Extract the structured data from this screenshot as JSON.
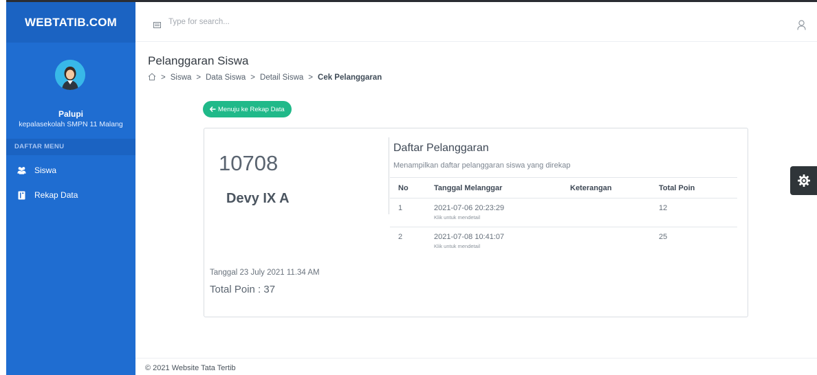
{
  "app": {
    "brand": "WEBTATIB.COM"
  },
  "sidebar": {
    "user": {
      "name": "Palupi",
      "role": "kepalasekolah SMPN 11 Malang"
    },
    "menu_heading": "DAFTAR MENU",
    "items": [
      {
        "label": "Siswa",
        "icon": "users-icon"
      },
      {
        "label": "Rekap Data",
        "icon": "book-icon"
      }
    ]
  },
  "header": {
    "search_placeholder": "Type for search..."
  },
  "page": {
    "title": "Pelanggaran Siswa",
    "breadcrumb": [
      "Siswa",
      "Data Siswa",
      "Detail Siswa",
      "Cek Pelanggaran"
    ],
    "back_button": "Menuju ke Rekap Data"
  },
  "student": {
    "nis": "10708",
    "name": "Devy IX A",
    "date_label": "Tanggal 23 July 2021 11.34 AM",
    "total_label": "Total Poin : 37"
  },
  "violations": {
    "title": "Daftar Pelanggaran",
    "subtitle": "Menampilkan daftar pelanggaran siswa yang direkap",
    "columns": [
      "No",
      "Tanggal Melanggar",
      "Keterangan",
      "Total Poin"
    ],
    "rows": [
      {
        "no": "1",
        "date": "2021-07-06 20:23:29",
        "hint": "Klik untuk mendetail",
        "keterangan": "",
        "points": "12"
      },
      {
        "no": "2",
        "date": "2021-07-08 10:41:07",
        "hint": "Klik untuk mendetail",
        "keterangan": "",
        "points": "25"
      }
    ]
  },
  "footer": {
    "text": "© 2021 Website Tata Tertib"
  },
  "colors": {
    "sidebar": "#1f6dd1",
    "brand_bar": "#1b63c2",
    "accent_button": "#20b989",
    "settings_tab": "#2f3539"
  }
}
